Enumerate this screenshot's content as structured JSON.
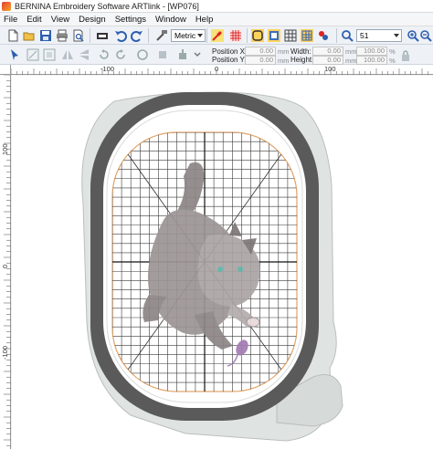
{
  "window": {
    "title": "BERNINA Embroidery Software ARTlink - [WP076]"
  },
  "menu": {
    "items": [
      "File",
      "Edit",
      "View",
      "Design",
      "Settings",
      "Window",
      "Help"
    ]
  },
  "toolbar": {
    "units_value": "Metric",
    "zoom_value": "51"
  },
  "position_bar": {
    "pos_x_label": "Position X:",
    "pos_y_label": "Position Y:",
    "width_label": "Width:",
    "height_label": "Height:",
    "pos_x_value": "0.00",
    "pos_y_value": "0.00",
    "width_value": "0.00",
    "height_value": "0.00",
    "width_pct": "100.00",
    "height_pct": "100.00",
    "unit_mm": "mm",
    "unit_pct": "%"
  },
  "rulers": {
    "top_labels": [
      "-100",
      "0",
      "100"
    ],
    "left_labels": [
      "100",
      "0",
      "-100"
    ]
  },
  "colors": {
    "hoop_dark": "#5a5a5a",
    "hoop_light": "#d4d8d6",
    "grid": "#3a3a3a",
    "boundary": "#e0a46a",
    "accent_mouse": "#a27bb3"
  }
}
